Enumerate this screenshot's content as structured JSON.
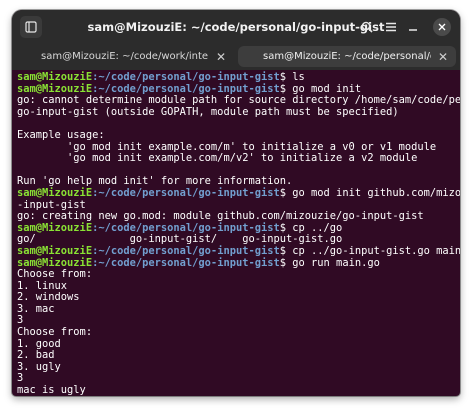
{
  "window": {
    "title": "sam@MizouziE: ~/code/personal/go-input-gist"
  },
  "icons": {
    "new_tab": "new-tab-icon",
    "search": "search-icon",
    "menu": "hamburger-menu-icon",
    "minimize": "minimize-icon",
    "close": "close-icon"
  },
  "tabs": [
    {
      "label": "sam@MizouziE: ~/code/work/intelli/c...",
      "active": false
    },
    {
      "label": "sam@MizouziE: ~/code/personal/go-i...",
      "active": true
    }
  ],
  "prompt": {
    "user": "sam@MizouziE",
    "path": ":~/code/personal/go-input-gist",
    "symbol": "$"
  },
  "colors": {
    "background": "#300a24",
    "prompt_user": "#8ae234",
    "prompt_path": "#729fcf",
    "text": "#ffffff"
  },
  "lines": [
    {
      "type": "prompt",
      "cmd": " ls"
    },
    {
      "type": "prompt",
      "cmd": " go mod init"
    },
    {
      "type": "out",
      "text": "go: cannot determine module path for source directory /home/sam/code/personal/"
    },
    {
      "type": "out",
      "text": "go-input-gist (outside GOPATH, module path must be specified)"
    },
    {
      "type": "out",
      "text": ""
    },
    {
      "type": "out",
      "text": "Example usage:"
    },
    {
      "type": "out",
      "text": "        'go mod init example.com/m' to initialize a v0 or v1 module"
    },
    {
      "type": "out",
      "text": "        'go mod init example.com/m/v2' to initialize a v2 module"
    },
    {
      "type": "out",
      "text": ""
    },
    {
      "type": "out",
      "text": "Run 'go help mod init' for more information."
    },
    {
      "type": "prompt",
      "cmd": " go mod init github.com/mizouzie/go"
    },
    {
      "type": "out",
      "text": "-input-gist"
    },
    {
      "type": "out",
      "text": "go: creating new go.mod: module github.com/mizouzie/go-input-gist"
    },
    {
      "type": "prompt",
      "cmd": " cp ../go"
    },
    {
      "type": "out",
      "text": "go/               go-input-gist/    go-input-gist.go"
    },
    {
      "type": "prompt",
      "cmd": " cp ../go-input-gist.go main.go"
    },
    {
      "type": "prompt",
      "cmd": " go run main.go"
    },
    {
      "type": "out",
      "text": "Choose from:"
    },
    {
      "type": "out",
      "text": "1. linux"
    },
    {
      "type": "out",
      "text": "2. windows"
    },
    {
      "type": "out",
      "text": "3. mac"
    },
    {
      "type": "out",
      "text": "3"
    },
    {
      "type": "out",
      "text": "Choose from:"
    },
    {
      "type": "out",
      "text": "1. good"
    },
    {
      "type": "out",
      "text": "2. bad"
    },
    {
      "type": "out",
      "text": "3. ugly"
    },
    {
      "type": "out",
      "text": "3"
    },
    {
      "type": "out",
      "text": "mac is ugly"
    },
    {
      "type": "prompt",
      "cmd": " ",
      "cursor": true
    }
  ]
}
